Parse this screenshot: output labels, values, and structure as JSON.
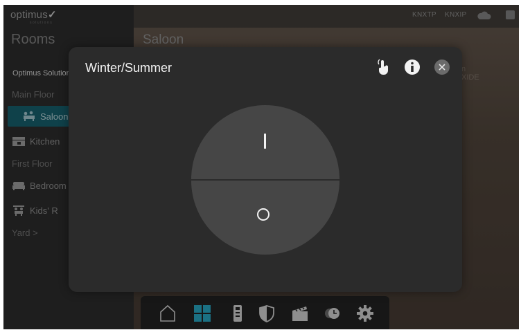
{
  "app": {
    "logo_text": "optimus",
    "logo_subtext": "solutions"
  },
  "sidebar": {
    "title": "Rooms",
    "org": "Optimus Solutions",
    "items": [
      {
        "label": "Main Floor",
        "kind": "floor"
      },
      {
        "label": "Saloon",
        "kind": "room",
        "icon": "sofa-people-icon",
        "active": true
      },
      {
        "label": "Kitchen",
        "kind": "room",
        "icon": "kitchen-icon"
      },
      {
        "label": "First Floor",
        "kind": "floor"
      },
      {
        "label": "Bedroom",
        "kind": "room",
        "icon": "bed-icon"
      },
      {
        "label": "Kids' R",
        "kind": "room",
        "icon": "kids-icon"
      },
      {
        "label": "Yard  >",
        "kind": "floor"
      }
    ]
  },
  "header": {
    "room_title": "Saloon",
    "status_knxtp": "KNXTP",
    "status_knxip": "KNXIP",
    "cloud_icon": "cloud-icon",
    "box_icon": "box-icon"
  },
  "background_fragment": {
    "line1": "n",
    "line2": "XIDE"
  },
  "modal": {
    "title": "Winter/Summer",
    "icons": [
      "touch-icon",
      "info-icon",
      "close-icon"
    ],
    "switch": {
      "on_symbol": "I",
      "off_symbol": "O",
      "state": "off"
    }
  },
  "bottom_nav": {
    "icons": [
      "home-icon",
      "grid-icon",
      "remote-icon",
      "shield-icon",
      "clapperboard-icon",
      "clock-icon",
      "gear-icon"
    ],
    "active": "grid-icon"
  },
  "colors": {
    "accent": "#0d5a68",
    "grid_active": "#1fa3c1",
    "modal_bg": "#2b2b2b",
    "knob": "#464646"
  }
}
